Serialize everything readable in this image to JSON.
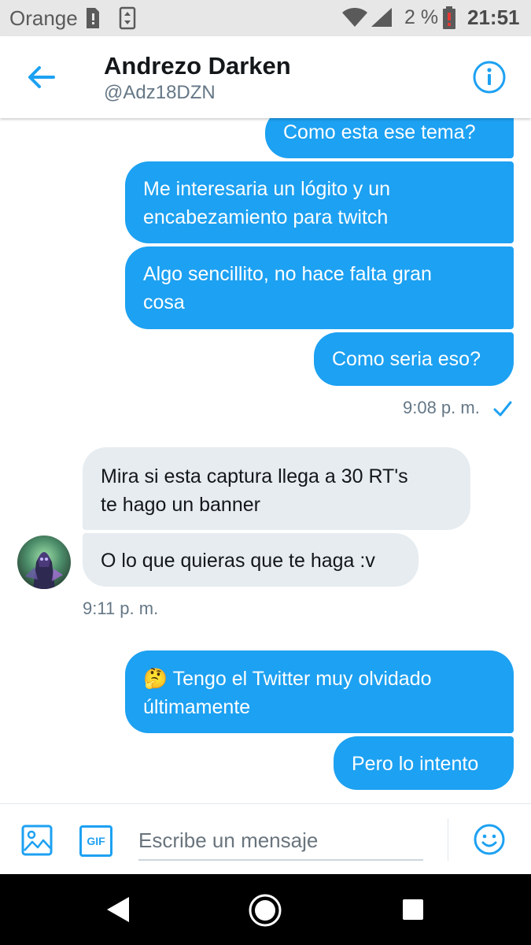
{
  "status_bar": {
    "carrier": "Orange",
    "battery_percent": "2 %",
    "time": "21:51",
    "icons": [
      "sim-card-icon",
      "data-saver-icon",
      "wifi-icon",
      "cell-signal-icon",
      "battery-low-icon"
    ]
  },
  "header": {
    "name": "Andrezo Darken",
    "handle": "@Adz18DZN",
    "icons": [
      "back-arrow-icon",
      "info-icon"
    ]
  },
  "messages": {
    "out1": "Como esta ese tema?",
    "out2": [
      "Me interesaria un lógito y un",
      "encabezamiento para twitch"
    ],
    "out3": [
      "Algo sencillito, no hace falta gran",
      "cosa"
    ],
    "out4": "Como seria eso?",
    "time1": "9:08 p. m.",
    "in1": [
      "Mira si esta captura llega a 30 RT's",
      "te hago un banner"
    ],
    "in2": "O lo que quieras que te haga :v",
    "time2": "9:11 p. m.",
    "out5_emoji": "🤔",
    "out5": [
      "Tengo el Twitter muy olvidado",
      "últimamente"
    ],
    "out6": "Pero lo intento"
  },
  "composer": {
    "placeholder": "Escribe un mensaje",
    "gif_label": "GIF",
    "icons": [
      "image-icon",
      "gif-icon",
      "emoji-icon"
    ]
  },
  "nav_bar": {
    "icons": [
      "nav-back-icon",
      "nav-home-icon",
      "nav-recents-icon"
    ]
  },
  "colors": {
    "accent": "#1da1f2",
    "incoming_bubble": "#e6ecf0",
    "status_bar": "#e7e7e7"
  }
}
